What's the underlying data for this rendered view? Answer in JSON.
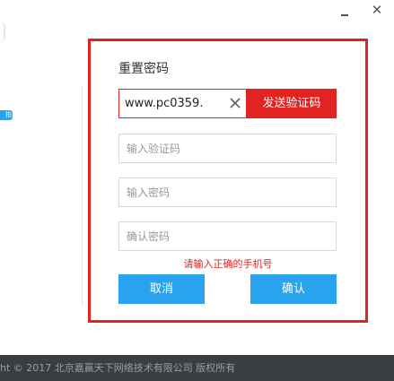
{
  "window": {
    "minimize_label": "",
    "close_label": "✕"
  },
  "sidebar": {
    "badge_text": "指南"
  },
  "dialog": {
    "title": "重置密码",
    "phone": {
      "value": "www.pc0359.",
      "clear_icon": "close-icon"
    },
    "send_code_label": "发送验证码",
    "code_placeholder": "输入验证码",
    "password_placeholder": "输入密码",
    "confirm_placeholder": "确认密码",
    "error_text": "请输入正确的手机号",
    "cancel_label": "取消",
    "confirm_label": "确认"
  },
  "footer": {
    "copyright": "ht © 2017 北京嘉赢天下网络技术有限公司 版权所有"
  },
  "colors": {
    "accent_red": "#e32222",
    "button_blue": "#2aa3ee",
    "footer_bg": "#3a3d42"
  }
}
